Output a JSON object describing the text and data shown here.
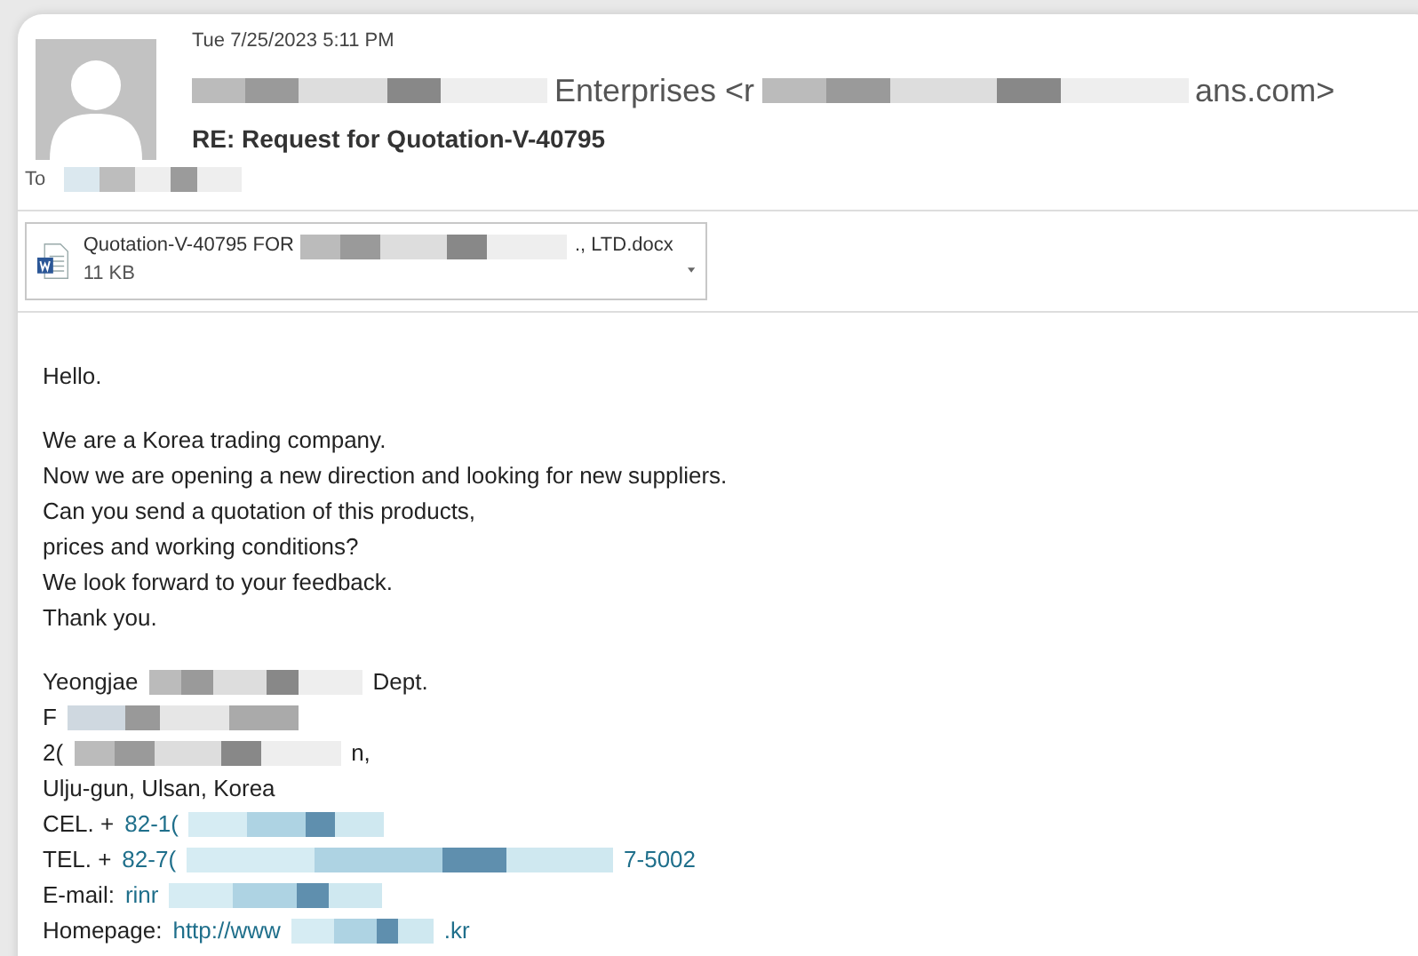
{
  "header": {
    "date": "Tue 7/25/2023 5:11 PM",
    "sender": [
      {
        "kind": "redacted"
      },
      {
        "kind": "text",
        "text": "Enterprises <r"
      },
      {
        "kind": "redacted"
      },
      {
        "kind": "text",
        "text": "ans.com>"
      }
    ],
    "subject": "RE: Request for Quotation-V-40795",
    "to_label": "To"
  },
  "attachment": {
    "name": [
      {
        "kind": "text",
        "text": "Quotation-V-40795 FOR"
      },
      {
        "kind": "redacted"
      },
      {
        "kind": "text",
        "text": "., LTD.docx"
      }
    ],
    "size": "11 KB"
  },
  "body": [
    [
      "Hello."
    ],
    [
      "We are a Korea trading company.",
      "Now we are opening a new direction and looking for new suppliers.",
      "Can you send a quotation of this products,",
      "prices and working conditions?",
      "We look forward to your feedback.",
      "Thank you."
    ]
  ],
  "signature": [
    [
      {
        "kind": "text",
        "text": "Yeongjae"
      },
      {
        "kind": "redacted"
      },
      {
        "kind": "text",
        "text": "Dept."
      }
    ],
    [
      {
        "kind": "text",
        "text": "F"
      },
      {
        "kind": "redacted"
      }
    ],
    [
      {
        "kind": "text",
        "text": "2("
      },
      {
        "kind": "redacted"
      },
      {
        "kind": "text",
        "text": "n,"
      }
    ],
    [
      {
        "kind": "text",
        "text": "Ulju-gun, Ulsan, Korea"
      }
    ],
    [
      {
        "kind": "text",
        "text": "CEL. +"
      },
      {
        "kind": "link",
        "text": "82-1("
      },
      {
        "kind": "redacted"
      }
    ],
    [
      {
        "kind": "text",
        "text": "TEL. +"
      },
      {
        "kind": "link",
        "text": "82-7("
      },
      {
        "kind": "redacted"
      },
      {
        "kind": "link",
        "text": "7-5002"
      }
    ],
    [
      {
        "kind": "text",
        "text": "E-mail:"
      },
      {
        "kind": "link",
        "text": "rinr"
      },
      {
        "kind": "redacted"
      }
    ],
    [
      {
        "kind": "text",
        "text": "Homepage:"
      },
      {
        "kind": "link",
        "text": "http://www"
      },
      {
        "kind": "redacted"
      },
      {
        "kind": "link",
        "text": ".kr"
      }
    ]
  ]
}
